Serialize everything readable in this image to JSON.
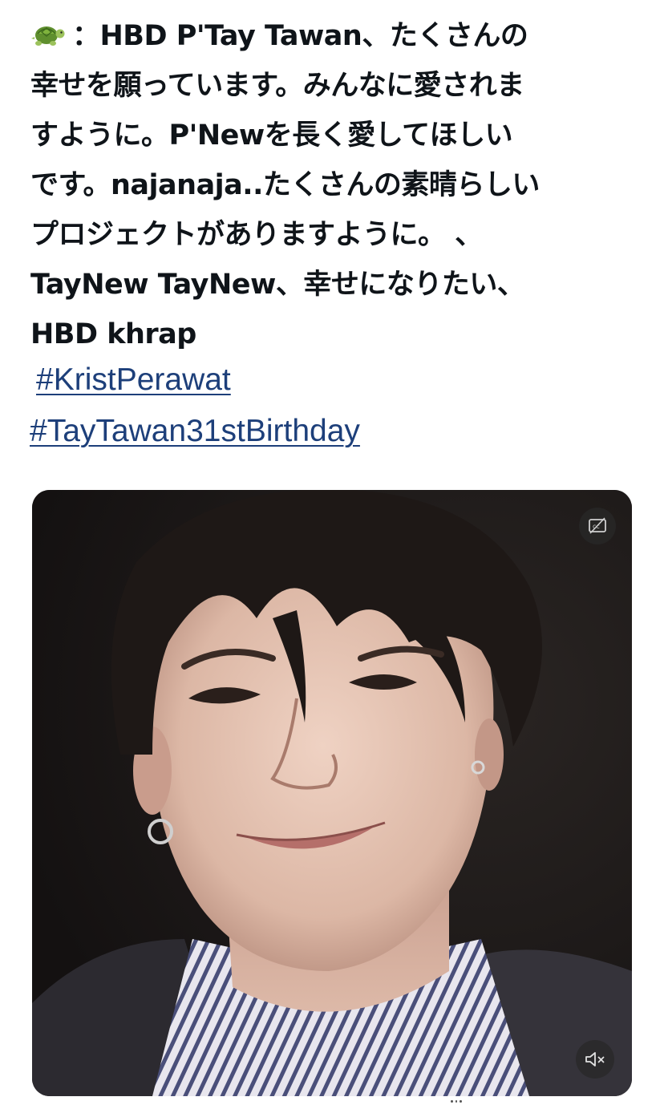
{
  "tweet": {
    "lines": [
      "：HBD P'Tay Tawan、たくさんの",
      "幸せを願っています。みんなに愛されま",
      "すように。P'Newを長く愛してほしい",
      "です。najanaja..たくさんの素晴らしい",
      "プロジェクトがありますように。 、",
      "TayNew TayNew、幸せになりたい、",
      "HBD khrap"
    ],
    "hashtags": [
      "#KristPerawat",
      "#TayTawan31stBirthday"
    ]
  },
  "video": {
    "cc_icon": "closed-captions-icon",
    "mute_icon": "volume-muted-icon"
  },
  "colors": {
    "text": "#0f1419",
    "hashtag": "#1d3f7a",
    "video_bg": "#1b1717"
  }
}
